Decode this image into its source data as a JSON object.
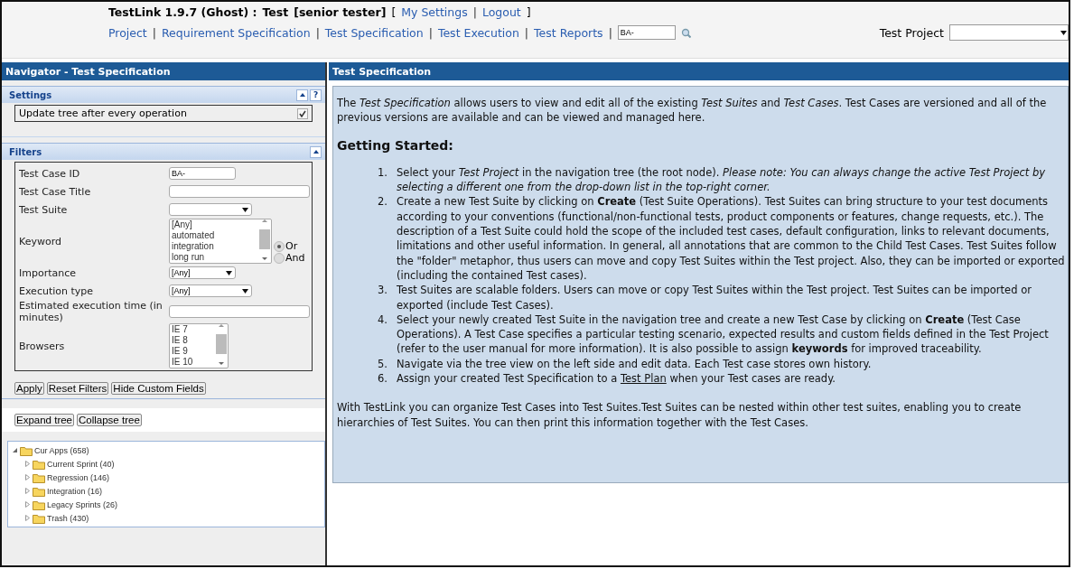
{
  "header": {
    "app_title": "TestLink 1.9.7 (Ghost) :",
    "project": "Test",
    "role": "[senior tester]",
    "open": "[",
    "close": "]",
    "separator": "|",
    "user_links": [
      "My Settings",
      "Logout"
    ],
    "menu": [
      "Project",
      "Requirement Specification",
      "Test Specification",
      "Test Execution",
      "Test Reports"
    ],
    "search": {
      "value": "BA-"
    },
    "project_select": {
      "label": "Test Project"
    }
  },
  "navigator": {
    "title": "Navigator - Test Specification",
    "settings": {
      "title": "Settings",
      "help": "?",
      "options": [
        {
          "label": "Update tree after every operation",
          "checked": true
        }
      ]
    },
    "filters": {
      "title": "Filters",
      "rows": [
        {
          "kind": "text",
          "label": "Test Case ID",
          "value": "BA-"
        },
        {
          "kind": "text",
          "label": "Test Case Title",
          "value": ""
        },
        {
          "kind": "select",
          "label": "Test Suite",
          "value": ""
        },
        {
          "kind": "listbox",
          "label": "Keyword",
          "options": [
            "[Any]",
            "automated",
            "integration",
            "long run"
          ],
          "radios": [
            {
              "label": "Or",
              "selected": true
            },
            {
              "label": "And",
              "selected": false
            }
          ]
        },
        {
          "kind": "select",
          "label": "Importance",
          "value": "[Any]"
        },
        {
          "kind": "select",
          "label": "Execution type",
          "value": "[Any]"
        },
        {
          "kind": "text",
          "label": "Estimated execution time (in minutes)",
          "value": ""
        },
        {
          "kind": "listbox",
          "label": "Browsers",
          "options": [
            "IE 7",
            "IE 8",
            "IE 9",
            "IE 10"
          ]
        }
      ]
    },
    "filter_buttons": [
      "Apply",
      "Reset Filters",
      "Hide Custom Fields"
    ],
    "tree_buttons": [
      "Expand tree",
      "Collapse tree"
    ],
    "tree": [
      {
        "label": "Cur Apps (658)",
        "expanded": true,
        "children": [
          {
            "label": "Current Sprint (40)",
            "expanded": false
          },
          {
            "label": "Regression (146)",
            "expanded": false
          },
          {
            "label": "Integration (16)",
            "expanded": false
          },
          {
            "label": "Legacy Sprints (26)",
            "expanded": false
          },
          {
            "label": "Trash (430)",
            "expanded": false
          }
        ]
      }
    ]
  },
  "content": {
    "title": "Test Specification",
    "intro": "The *Test Specification* allows users to view and edit all of the existing *Test Suites* and *Test Cases*. Test Cases are versioned and all of the previous versions are available and can be viewed and managed here.",
    "heading": "Getting Started:",
    "steps": [
      {
        "number": "1.",
        "text": "Select your *Test Project* in the navigation tree (the root node). *Please note: You can always change the active Test Project by selecting a different one from the drop-down list in the top-right corner.*"
      },
      {
        "number": "2.",
        "text": "Create a new Test Suite by clicking on **Create** (Test Suite Operations). Test Suites can bring structure to your test documents according to your conventions (functional/non-functional tests, product components or features, change requests, etc.). The description of a Test Suite could hold the scope of the included test cases, default configuration, links to relevant documents, limitations and other useful information. In general, all annotations that are common to the Child Test Cases. Test Suites follow the \"folder\" metaphor, thus users can move and copy Test Suites within the Test project. Also, they can be imported or exported (including the contained Test cases)."
      },
      {
        "number": "3.",
        "text": "Test Suites are scalable folders. Users can move or copy Test Suites within the Test project. Test Suites can be imported or exported (include Test Cases)."
      },
      {
        "number": "4.",
        "text": "Select your newly created Test Suite in the navigation tree and create a new Test Case by clicking on **Create** (Test Case Operations). A Test Case specifies a particular testing scenario, expected results and custom fields defined in the Test Project (refer to the user manual for more information). It is also possible to assign **keywords** for improved traceability."
      },
      {
        "number": "5.",
        "text": "Navigate via the tree view on the left side and edit data. Each Test case stores own history."
      },
      {
        "number": "6.",
        "text": "Assign your created Test Specification to a",
        "link": "Test Plan",
        "after": "when your Test cases are ready."
      }
    ],
    "outro": "With TestLink you can organize Test Cases into Test Suites.Test Suites can be nested within other test suites, enabling you to create hierarchies of Test Suites. You can then print this information together with the Test Cases."
  }
}
